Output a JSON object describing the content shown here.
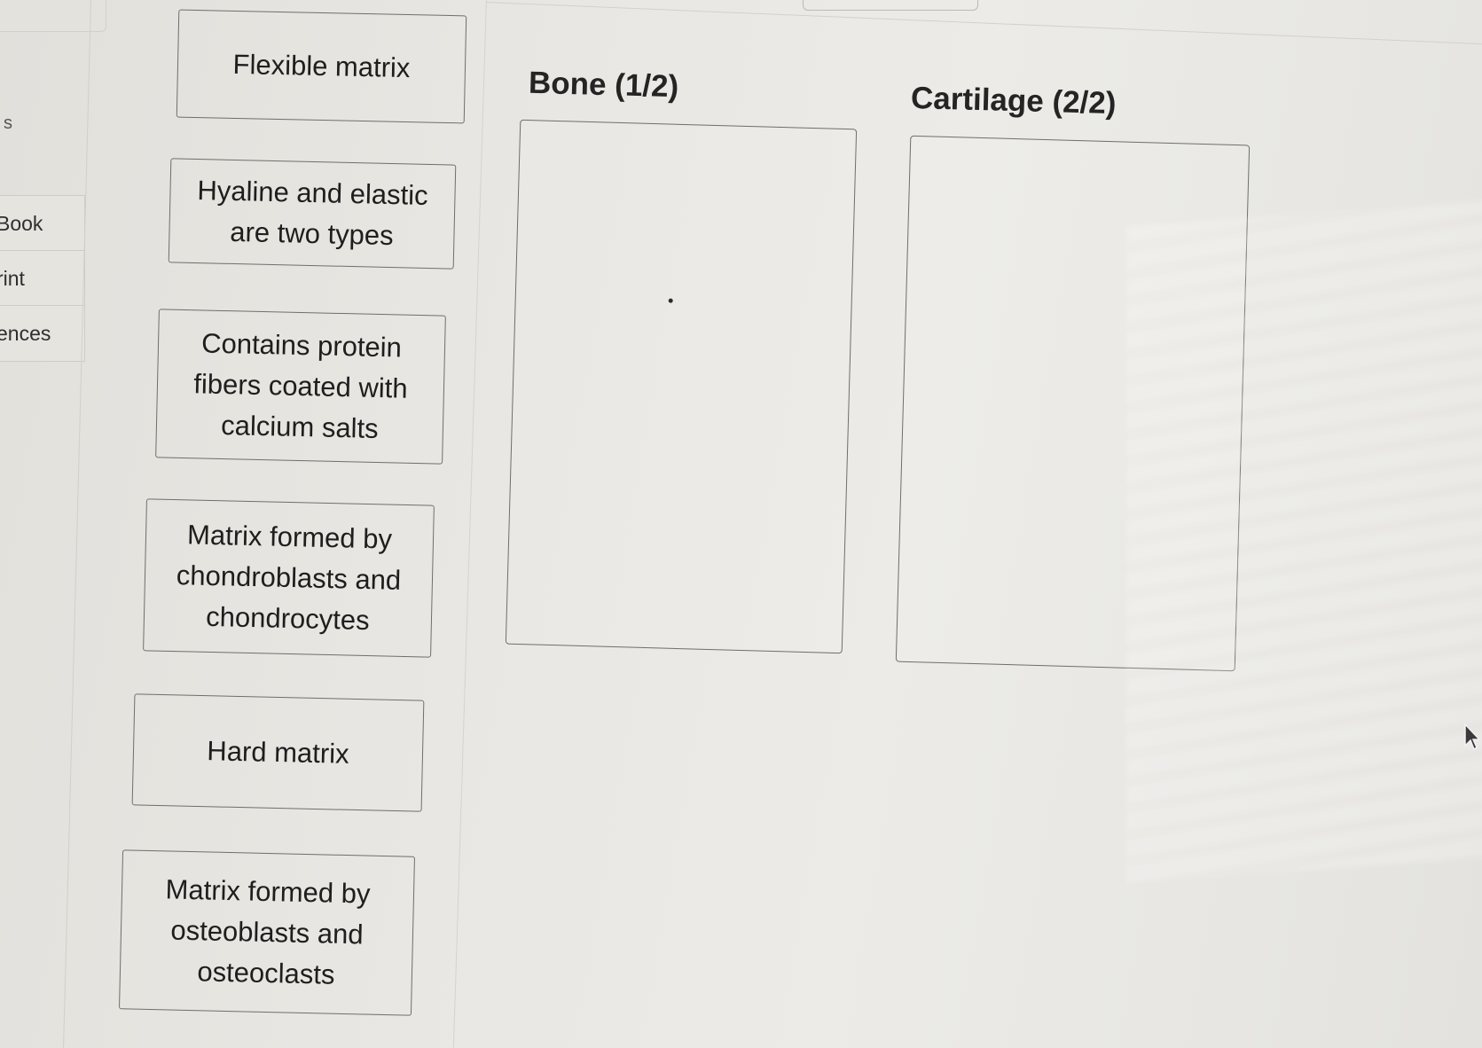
{
  "sidebar": {
    "items": [
      {
        "label": "Book"
      },
      {
        "label": "rint"
      },
      {
        "label": "ences"
      }
    ],
    "stray_char": "s"
  },
  "answer_bank": {
    "cards": [
      {
        "label": "Flexible matrix"
      },
      {
        "label": "Hyaline and elastic are two types"
      },
      {
        "label": "Contains protein fibers coated with calcium salts"
      },
      {
        "label": "Matrix formed by chondroblasts and chondrocytes"
      },
      {
        "label": "Hard matrix"
      },
      {
        "label": "Matrix formed by osteoblasts and osteoclasts"
      }
    ]
  },
  "categories": [
    {
      "title": "Bone (1/2)"
    },
    {
      "title": "Cartilage (2/2)"
    }
  ],
  "colors": {
    "background": "#e9e7e2",
    "border": "#6e6e6e",
    "text": "#1f1f1f"
  },
  "icons": {
    "cursor": "mouse-pointer-icon"
  }
}
